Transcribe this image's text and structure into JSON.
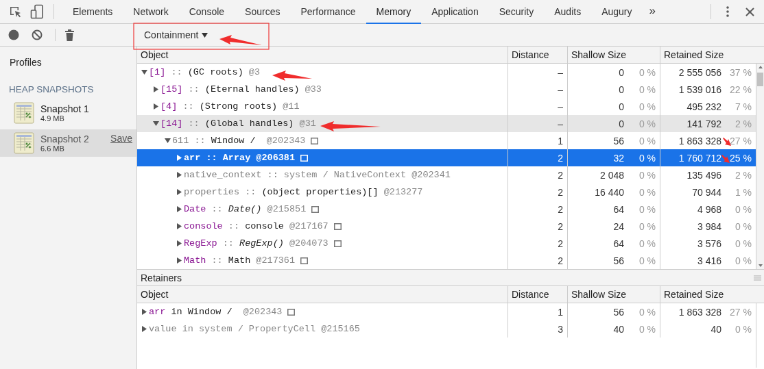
{
  "tabs": [
    {
      "label": "Elements",
      "selected": false
    },
    {
      "label": "Network",
      "selected": false
    },
    {
      "label": "Console",
      "selected": false
    },
    {
      "label": "Sources",
      "selected": false
    },
    {
      "label": "Performance",
      "selected": false
    },
    {
      "label": "Memory",
      "selected": true
    },
    {
      "label": "Application",
      "selected": false
    },
    {
      "label": "Security",
      "selected": false
    },
    {
      "label": "Audits",
      "selected": false
    },
    {
      "label": "Augury",
      "selected": false
    }
  ],
  "overflow": "»",
  "toolbar": {
    "view_dropdown": "Containment"
  },
  "sidebar": {
    "title": "Profiles",
    "section": "HEAP SNAPSHOTS",
    "snapshots": [
      {
        "name": "Snapshot 1",
        "size": "4.9 MB",
        "selected": false
      },
      {
        "name": "Snapshot 2",
        "size": "6.6 MB",
        "selected": true,
        "action": "Save"
      }
    ]
  },
  "columns": [
    "Object",
    "Distance",
    "Shallow Size",
    "Retained Size"
  ],
  "tree": [
    {
      "name": "[1]",
      "color": "#881391",
      "connector": "::",
      "class": "(GC roots)",
      "italic": false,
      "dimmed": false,
      "id": "@3",
      "expanded": true,
      "selected": false,
      "highlighted": false,
      "reveal_icon": false,
      "distance": "–",
      "shallow": "0",
      "shallow_pct": "0 %",
      "retained": "2 555 056",
      "retained_pct": "37 %",
      "children": [
        {
          "name": "[15]",
          "color": "#881391",
          "connector": "::",
          "class": "(Eternal handles)",
          "italic": false,
          "dimmed": false,
          "id": "@33",
          "expanded": false,
          "selected": false,
          "highlighted": false,
          "reveal_icon": false,
          "distance": "–",
          "shallow": "0",
          "shallow_pct": "0 %",
          "retained": "1 539 016",
          "retained_pct": "22 %"
        },
        {
          "name": "[4]",
          "color": "#881391",
          "connector": "::",
          "class": "(Strong roots)",
          "italic": false,
          "dimmed": false,
          "id": "@11",
          "expanded": false,
          "selected": false,
          "highlighted": false,
          "reveal_icon": false,
          "distance": "–",
          "shallow": "0",
          "shallow_pct": "0 %",
          "retained": "495 232",
          "retained_pct": "7 %"
        },
        {
          "name": "[14]",
          "color": "#881391",
          "connector": "::",
          "class": "(Global handles)",
          "italic": false,
          "dimmed": false,
          "id": "@31",
          "expanded": true,
          "selected": false,
          "highlighted": true,
          "reveal_icon": false,
          "distance": "–",
          "shallow": "0",
          "shallow_pct": "0 %",
          "retained": "141 792",
          "retained_pct": "2 %",
          "children": [
            {
              "name": "611",
              "color": "#808080",
              "connector": "::",
              "class": "Window / ",
              "italic": false,
              "dimmed": false,
              "id": "@202343",
              "expanded": true,
              "selected": false,
              "highlighted": false,
              "reveal_icon": true,
              "distance": "1",
              "shallow": "56",
              "shallow_pct": "0 %",
              "retained": "1 863 328",
              "retained_pct": "27 %",
              "children": [
                {
                  "name": "arr",
                  "color": "#ffffff",
                  "connector": "::",
                  "class": "Array",
                  "italic": false,
                  "dimmed": false,
                  "id": "@206381",
                  "expanded": false,
                  "selected": true,
                  "highlighted": false,
                  "reveal_icon": true,
                  "distance": "2",
                  "shallow": "32",
                  "shallow_pct": "0 %",
                  "retained": "1 760 712",
                  "retained_pct": "25 %"
                },
                {
                  "name": "native_context",
                  "color": "#808080",
                  "connector": "::",
                  "class": "system / NativeContext",
                  "italic": false,
                  "dimmed": true,
                  "id": "@202341",
                  "expanded": false,
                  "selected": false,
                  "highlighted": false,
                  "reveal_icon": false,
                  "distance": "2",
                  "shallow": "2 048",
                  "shallow_pct": "0 %",
                  "retained": "135 496",
                  "retained_pct": "2 %"
                },
                {
                  "name": "properties",
                  "color": "#808080",
                  "connector": "::",
                  "class": "(object properties)[]",
                  "italic": false,
                  "dimmed": false,
                  "id": "@213277",
                  "expanded": false,
                  "selected": false,
                  "highlighted": false,
                  "reveal_icon": false,
                  "distance": "2",
                  "shallow": "16 440",
                  "shallow_pct": "0 %",
                  "retained": "70 944",
                  "retained_pct": "1 %"
                },
                {
                  "name": "Date",
                  "color": "#881391",
                  "connector": "::",
                  "class": "Date()",
                  "italic": true,
                  "dimmed": false,
                  "id": "@215851",
                  "expanded": false,
                  "selected": false,
                  "highlighted": false,
                  "reveal_icon": true,
                  "distance": "2",
                  "shallow": "64",
                  "shallow_pct": "0 %",
                  "retained": "4 968",
                  "retained_pct": "0 %"
                },
                {
                  "name": "console",
                  "color": "#881391",
                  "connector": "::",
                  "class": "console",
                  "italic": false,
                  "dimmed": false,
                  "id": "@217167",
                  "expanded": false,
                  "selected": false,
                  "highlighted": false,
                  "reveal_icon": true,
                  "distance": "2",
                  "shallow": "24",
                  "shallow_pct": "0 %",
                  "retained": "3 984",
                  "retained_pct": "0 %"
                },
                {
                  "name": "RegExp",
                  "color": "#881391",
                  "connector": "::",
                  "class": "RegExp()",
                  "italic": true,
                  "dimmed": false,
                  "id": "@204073",
                  "expanded": false,
                  "selected": false,
                  "highlighted": false,
                  "reveal_icon": true,
                  "distance": "2",
                  "shallow": "64",
                  "shallow_pct": "0 %",
                  "retained": "3 576",
                  "retained_pct": "0 %"
                },
                {
                  "name": "Math",
                  "color": "#881391",
                  "connector": "::",
                  "class": "Math",
                  "italic": false,
                  "dimmed": false,
                  "id": "@217361",
                  "expanded": false,
                  "selected": false,
                  "highlighted": false,
                  "reveal_icon": true,
                  "distance": "2",
                  "shallow": "56",
                  "shallow_pct": "0 %",
                  "retained": "3 416",
                  "retained_pct": "0 %"
                }
              ]
            }
          ]
        }
      ]
    }
  ],
  "retainers": {
    "title": "Retainers",
    "columns": [
      "Object",
      "Distance",
      "Shallow Size",
      "Retained Size"
    ],
    "rows": [
      {
        "name": "arr",
        "color": "#881391",
        "connector": "in",
        "class": "Window / ",
        "italic": false,
        "dimmed": false,
        "id": "@202343",
        "expanded": false,
        "selected": false,
        "highlighted": false,
        "reveal_icon": true,
        "distance": "1",
        "shallow": "56",
        "shallow_pct": "0 %",
        "retained": "1 863 328",
        "retained_pct": "27 %"
      },
      {
        "name": "value",
        "color": "#808080",
        "connector": "in",
        "class": "system / PropertyCell",
        "italic": false,
        "dimmed": true,
        "id": "@215165",
        "expanded": false,
        "selected": false,
        "highlighted": false,
        "reveal_icon": false,
        "distance": "3",
        "shallow": "40",
        "shallow_pct": "0 %",
        "retained": "40",
        "retained_pct": "0 %"
      }
    ]
  }
}
